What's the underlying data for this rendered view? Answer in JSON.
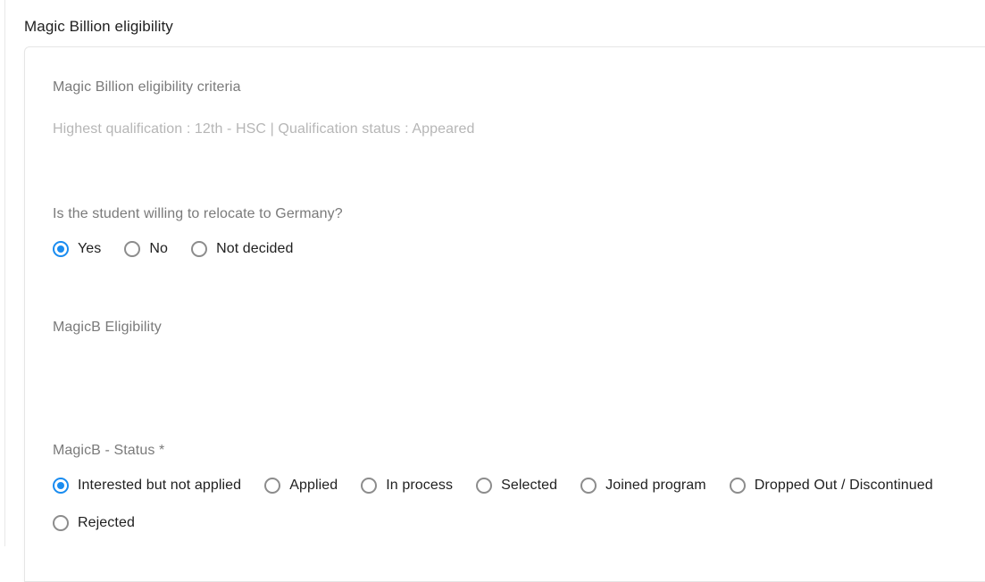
{
  "page": {
    "title": "Magic Billion eligibility"
  },
  "card": {
    "criteria_heading": "Magic Billion eligibility criteria",
    "criteria_summary": "Highest qualification : 12th - HSC | Qualification status : Appeared",
    "relocate": {
      "question": "Is the student willing to relocate to Germany?",
      "options": [
        {
          "label": "Yes",
          "selected": true
        },
        {
          "label": "No",
          "selected": false
        },
        {
          "label": "Not decided",
          "selected": false
        }
      ]
    },
    "eligibility": {
      "label": "MagicB Eligibility"
    },
    "status": {
      "label": "MagicB - Status *",
      "options": [
        {
          "label": "Interested but not applied",
          "selected": true
        },
        {
          "label": "Applied",
          "selected": false
        },
        {
          "label": "In process",
          "selected": false
        },
        {
          "label": "Selected",
          "selected": false
        },
        {
          "label": "Joined program",
          "selected": false
        },
        {
          "label": "Dropped Out / Discontinued",
          "selected": false
        },
        {
          "label": "Rejected",
          "selected": false
        }
      ]
    }
  },
  "colors": {
    "accent": "#1a8cf0",
    "title_text": "#212121",
    "label_text": "#7a7a7a",
    "muted_text": "#b6b6b6",
    "option_text": "#1f1f1f",
    "card_border": "#e6e6e6"
  }
}
